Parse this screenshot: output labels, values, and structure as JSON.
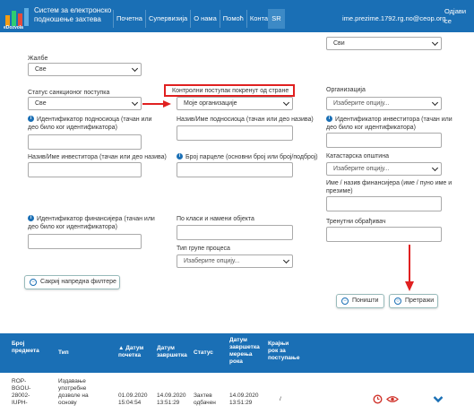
{
  "header": {
    "logo_text": "eDozvola",
    "app_title": "Систем за електронско подношење захтева",
    "nav": [
      "Почетна",
      "Супервизија",
      "О нама",
      "Помоћ",
      "Контакт"
    ],
    "language": "SR",
    "user_email": "ime.prezime.1792.rg.no@ceop.org",
    "logout": "Одјави се"
  },
  "colors": {
    "primary": "#1a6fb5",
    "highlight": "#e02020"
  },
  "filters": {
    "top_right_select": "Сви",
    "complaints_label": "Жалбе",
    "complaints_value": "Све",
    "sanction_status_label": "Статус санкционог поступка",
    "sanction_status_value": "Све",
    "control_initiated_label": "Контролни поступак покренут од стране",
    "control_initiated_value": "Моје организације",
    "organization_label": "Организација",
    "organization_placeholder": "Изаберите опцију...",
    "applicant_id_label": "Идентификатор подносиоца (тачан или део било ког идентификатора)",
    "applicant_name_label": "Назив/Име подносиоца (тачан или део назива)",
    "investor_id_label": "Идентификатор инвеститора (тачан или део било ког идентификатора)",
    "investor_name_label": "Назив/Име инвеститора (тачан или део назива)",
    "parcel_number_label": "Број парцеле (основни број или број/подброј)",
    "cadastral_municipality_label": "Катастарска општина",
    "cadastral_municipality_placeholder": "Изаберите опцију...",
    "financier_name_label": "Име / назив финансијера (име / пуно име и презиме)",
    "financier_id_label": "Идентификатор финансијера (тачан или део било ког идентификатора)",
    "object_class_label": "По класи и намени објекта",
    "process_group_label": "Тип групе процеса",
    "process_group_placeholder": "Изаберите опцију...",
    "current_processor_label": "Тренутни обрађивач",
    "hide_filters_button": "Сакриј напредна филтере",
    "reset_button": "Поништи",
    "search_button": "Претражи"
  },
  "table": {
    "headers": [
      "Број предмета",
      "Тип",
      "▲ Датум почетка",
      "Датум завршетка",
      "Статус",
      "Датум завршетка мерења рока",
      "Крајњи рок за поступање"
    ],
    "rows": [
      {
        "case_number": "ROP-BGOU-28002-IUPH-",
        "type": "Издавање употребне дозволе на основу",
        "start_date": "01.09.2020 15:04:54",
        "end_date": "14.09.2020 13:51:29",
        "status": "Захтев одбачен",
        "deadline_measure_end": "14.09.2020 13:51:29",
        "final_deadline": "/"
      }
    ]
  }
}
